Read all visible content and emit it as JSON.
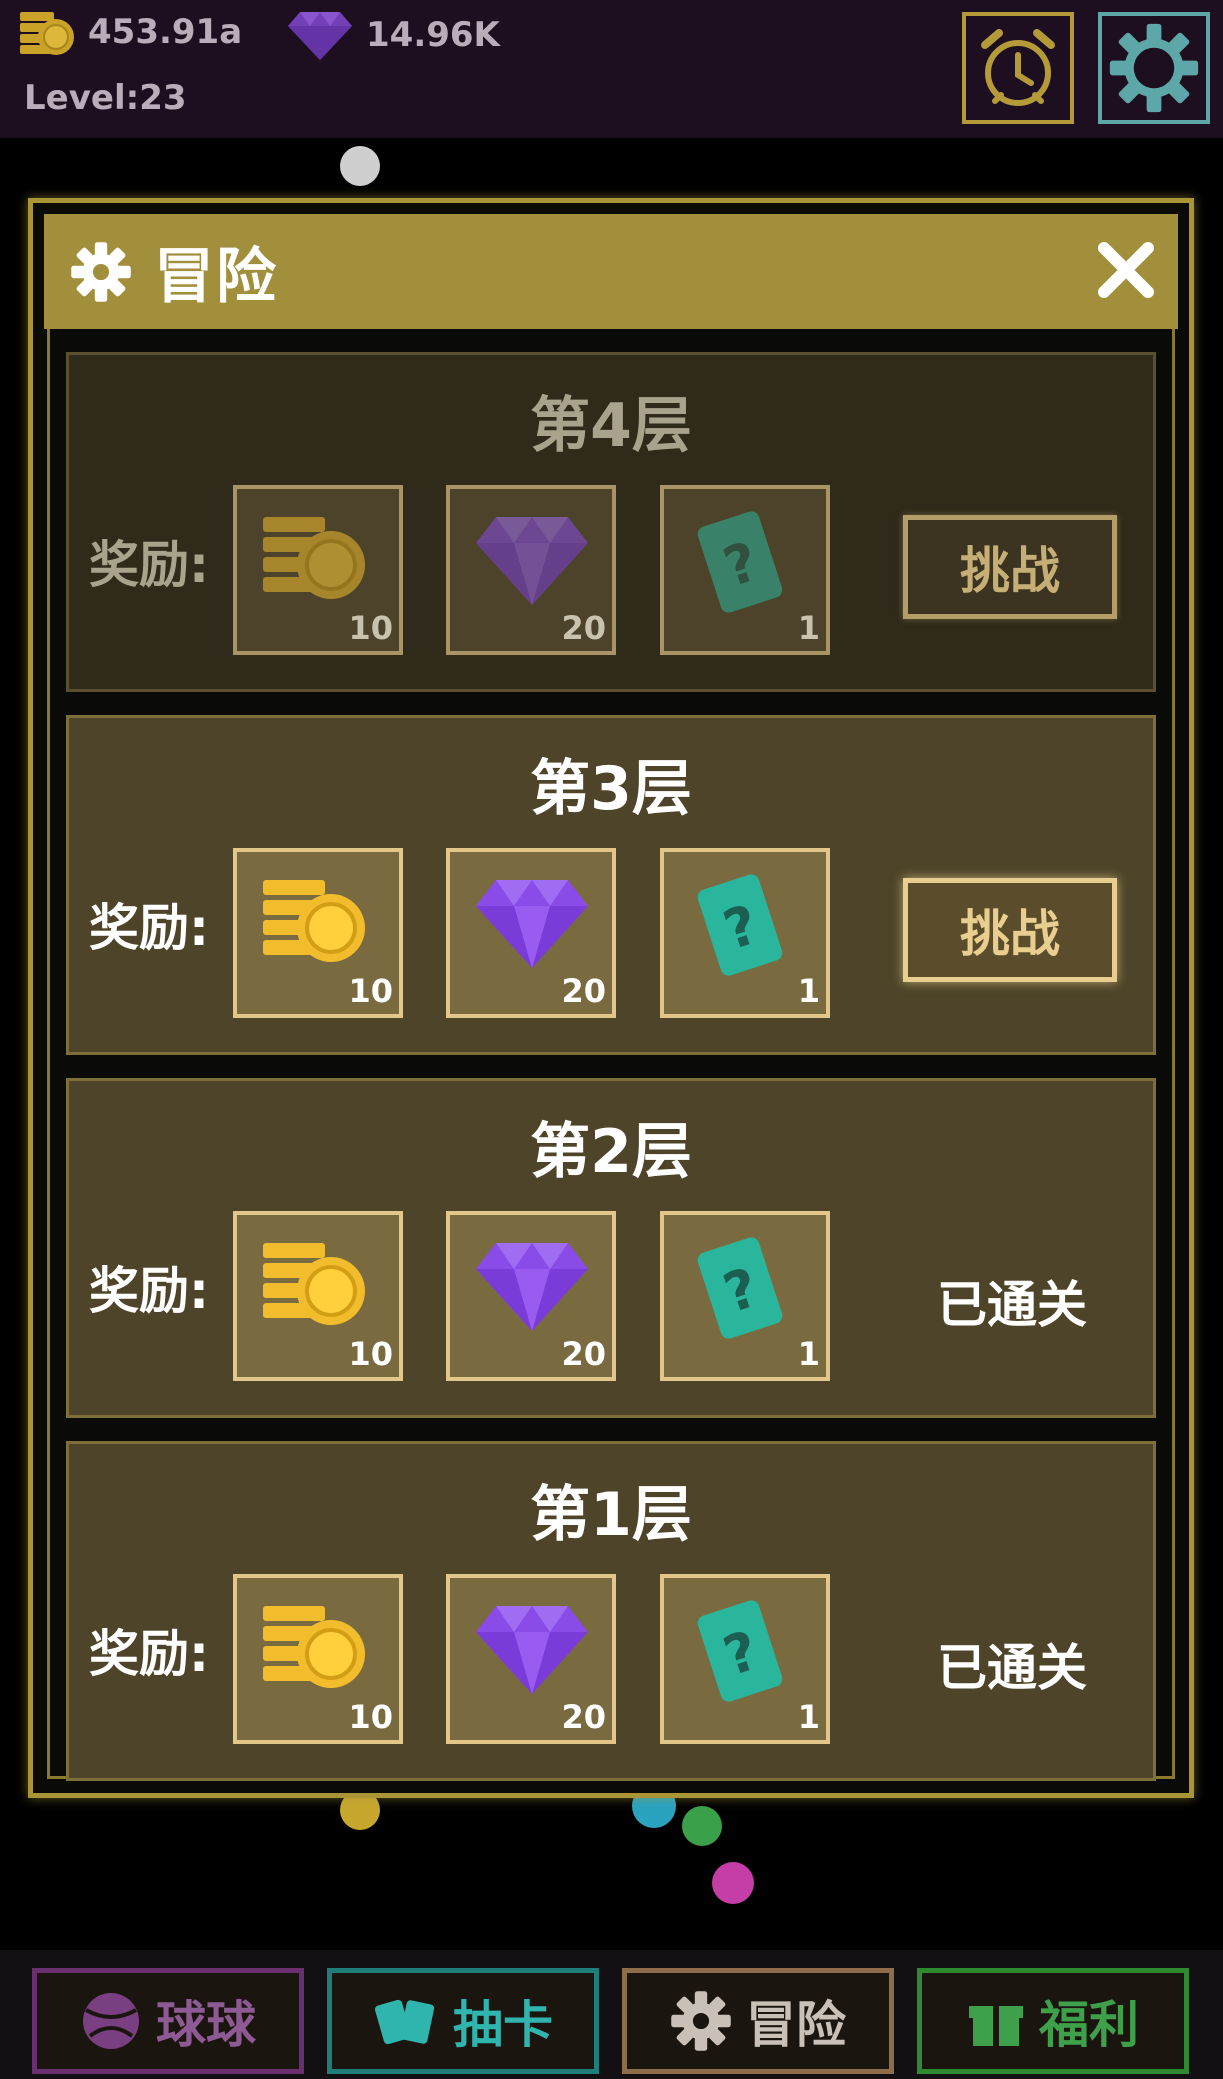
{
  "topbar": {
    "coins": "453.91a",
    "gems": "14.96K",
    "level": "Level:23"
  },
  "modal": {
    "title": "冒险",
    "floors": [
      {
        "title": "第4层",
        "reward_label": "奖励:",
        "rewards": {
          "coins": "10",
          "gems": "20",
          "cards": "1"
        },
        "action_label": "挑战",
        "state": "locked"
      },
      {
        "title": "第3层",
        "reward_label": "奖励:",
        "rewards": {
          "coins": "10",
          "gems": "20",
          "cards": "1"
        },
        "action_label": "挑战",
        "state": "available"
      },
      {
        "title": "第2层",
        "reward_label": "奖励:",
        "rewards": {
          "coins": "10",
          "gems": "20",
          "cards": "1"
        },
        "status_label": "已通关",
        "state": "cleared"
      },
      {
        "title": "第1层",
        "reward_label": "奖励:",
        "rewards": {
          "coins": "10",
          "gems": "20",
          "cards": "1"
        },
        "status_label": "已通关",
        "state": "cleared"
      }
    ]
  },
  "bottom_nav": {
    "balls": "球球",
    "cards": "抽卡",
    "adventure": "冒险",
    "welfare": "福利"
  },
  "colors": {
    "modal_header": "#a28f3c",
    "card_bg": "#4d4429",
    "gem": "#8a4ce8",
    "coin": "#f2bd2c",
    "card": "#2ab59d"
  }
}
